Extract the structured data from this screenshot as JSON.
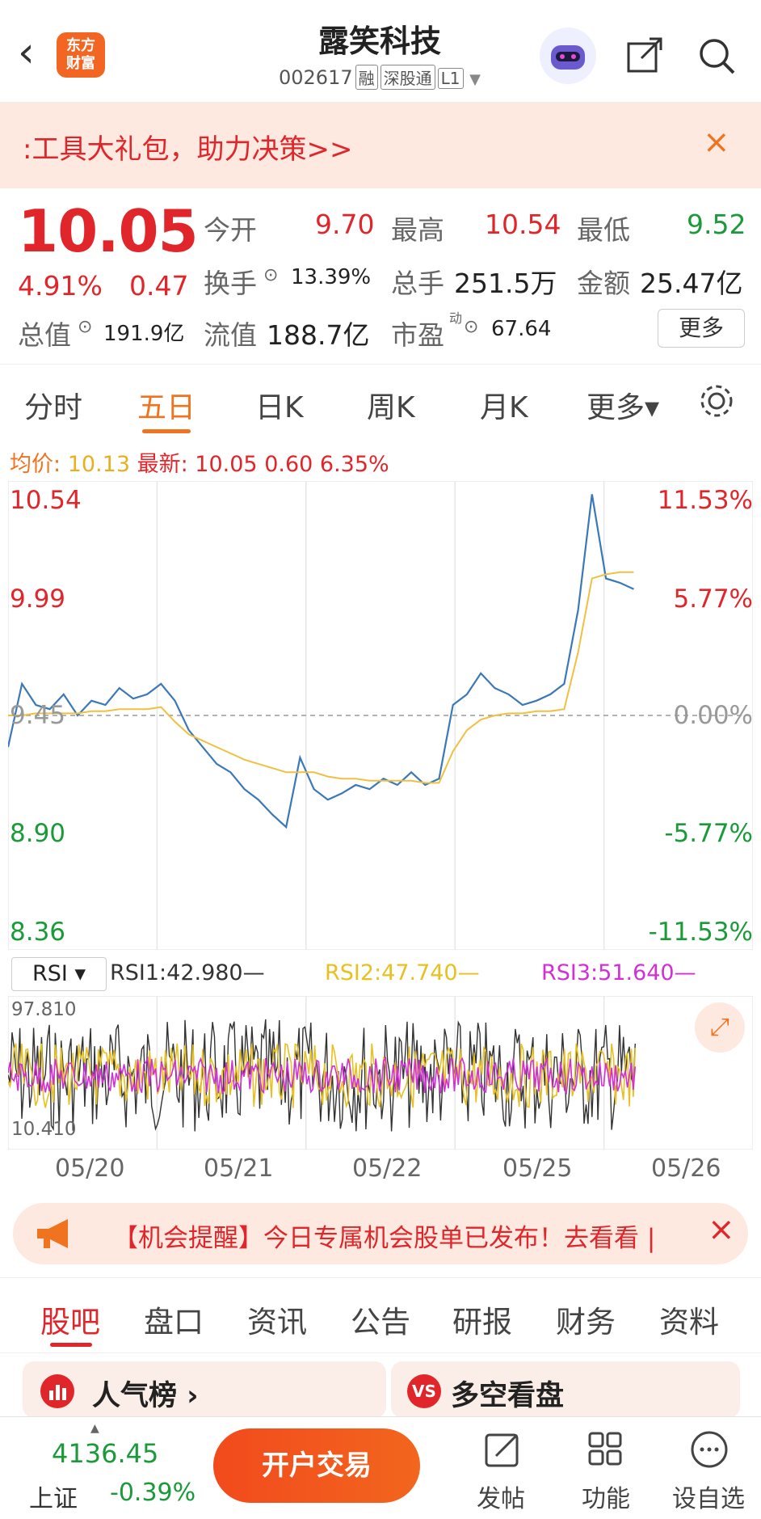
{
  "header": {
    "back_glyph": "‹",
    "logo_line1": "东方",
    "logo_line2": "财富",
    "title": "露笑科技",
    "code": "002617",
    "tags": [
      "融",
      "深股通",
      "L1"
    ]
  },
  "banner": {
    "text": ":工具大礼包，助力决策>>",
    "close": "×"
  },
  "quote": {
    "price": "10.05",
    "change_pct": "4.91%",
    "change": "0.47",
    "open_label": "今开",
    "open": "9.70",
    "high_label": "最高",
    "high": "10.54",
    "low_label": "最低",
    "low": "9.52",
    "turnover_label": "换手",
    "turnover": "13.39%",
    "volume_label": "总手",
    "volume": "251.5万",
    "amount_label": "金额",
    "amount": "25.47亿",
    "mktcap_label": "总值",
    "mktcap": "191.9亿",
    "float_label": "流值",
    "float_cap": "188.7亿",
    "pe_label": "市盈",
    "pe_sup": "动",
    "pe": "67.64",
    "more": "更多"
  },
  "tabs": [
    "分时",
    "五日",
    "日K",
    "周K",
    "月K",
    "更多▾"
  ],
  "avg_line": {
    "avg_label": "均价:",
    "avg": "10.13",
    "latest_label": "最新:",
    "latest": "10.05",
    "change": "0.60",
    "pct": "6.35%"
  },
  "colors": {
    "up": "#e0262b",
    "down": "#1b9a3a",
    "accent": "#f0731f",
    "price_line": "#3a78b8",
    "avg_line": "#f0c040",
    "rsi1": "#333333",
    "rsi2": "#e8c020",
    "rsi3": "#d22fd6"
  },
  "chart_data": [
    {
      "type": "line",
      "title": "五日",
      "x": [
        "05/20",
        "05/21",
        "05/22",
        "05/25",
        "05/26"
      ],
      "y_ticks_left": [
        "10.54",
        "9.99",
        "9.45",
        "8.90",
        "8.36"
      ],
      "y_ticks_right": [
        "11.53%",
        "5.77%",
        "0.00%",
        "-5.77%",
        "-11.53%"
      ],
      "ylim": [
        8.36,
        10.54
      ],
      "reference": 9.45,
      "series": [
        {
          "name": "price",
          "values": [
            9.3,
            9.6,
            9.5,
            9.48,
            9.55,
            9.45,
            9.52,
            9.5,
            9.58,
            9.53,
            9.55,
            9.6,
            9.52,
            9.38,
            9.3,
            9.22,
            9.18,
            9.1,
            9.05,
            8.98,
            8.92,
            9.25,
            9.1,
            9.05,
            9.08,
            9.12,
            9.1,
            9.15,
            9.12,
            9.18,
            9.12,
            9.15,
            9.5,
            9.55,
            9.65,
            9.58,
            9.55,
            9.5,
            9.52,
            9.55,
            9.6,
            9.95,
            10.5,
            10.1,
            10.08,
            10.05
          ]
        },
        {
          "name": "avg",
          "values": [
            9.45,
            9.45,
            9.46,
            9.46,
            9.46,
            9.46,
            9.47,
            9.47,
            9.48,
            9.48,
            9.48,
            9.49,
            9.42,
            9.36,
            9.33,
            9.3,
            9.27,
            9.24,
            9.22,
            9.2,
            9.18,
            9.18,
            9.18,
            9.16,
            9.15,
            9.15,
            9.14,
            9.14,
            9.14,
            9.14,
            9.13,
            9.13,
            9.28,
            9.38,
            9.43,
            9.45,
            9.46,
            9.46,
            9.47,
            9.47,
            9.48,
            9.75,
            10.1,
            10.12,
            10.13,
            10.13
          ]
        }
      ]
    },
    {
      "type": "line",
      "title": "RSI",
      "legend": [
        "RSI1:42.980—",
        "RSI2:47.740—",
        "RSI3:51.640—"
      ],
      "indicator": "RSI ▾",
      "y_max_label": "97.810",
      "y_min_label": "10.410",
      "ylim": [
        10.41,
        97.81
      ]
    }
  ],
  "dates": [
    "05/20",
    "05/21",
    "05/22",
    "05/25",
    "05/26"
  ],
  "reminder": {
    "text": "【机会提醒】今日专属机会股单已发布！去看看 |",
    "close": "×"
  },
  "bottom_tabs": [
    "股吧",
    "盘口",
    "资讯",
    "公告",
    "研报",
    "财务",
    "资料"
  ],
  "cards": [
    {
      "title": "人气榜 ›"
    },
    {
      "title": "多空看盘"
    }
  ],
  "footer": {
    "index_value": "4136.45",
    "index_name": "上证",
    "index_change": "-0.39%",
    "trade_button": "开户交易",
    "post": "发帖",
    "func": "功能",
    "watch": "设自选"
  }
}
